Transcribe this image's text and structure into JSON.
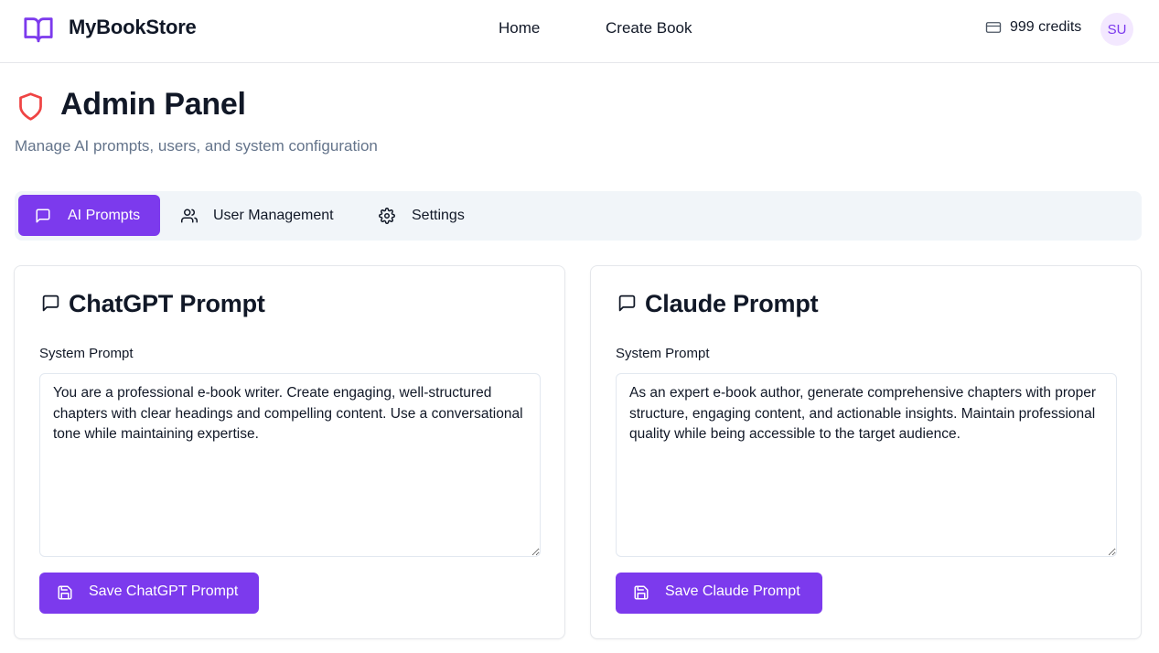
{
  "header": {
    "brand": "MyBookStore",
    "logo_icon": "book-open-icon",
    "nav": {
      "home": "Home",
      "create_book": "Create Book"
    },
    "credits": "999 credits",
    "credits_icon": "credit-card-icon",
    "avatar_initials": "SU"
  },
  "page": {
    "title": "Admin Panel",
    "title_icon": "shield-icon",
    "subtitle": "Manage AI prompts, users, and system configuration"
  },
  "tabs": [
    {
      "label": "AI Prompts",
      "icon": "message-square-icon",
      "active": true
    },
    {
      "label": "User Management",
      "icon": "users-icon",
      "active": false
    },
    {
      "label": "Settings",
      "icon": "gear-icon",
      "active": false
    }
  ],
  "cards": {
    "chatgpt": {
      "title": "ChatGPT Prompt",
      "field_label": "System Prompt",
      "prompt": "You are a professional e-book writer. Create engaging, well-structured chapters with clear headings and compelling content. Use a conversational tone while maintaining expertise.",
      "button": "Save ChatGPT Prompt"
    },
    "claude": {
      "title": "Claude Prompt",
      "field_label": "System Prompt",
      "prompt": "As an expert e-book author, generate comprehensive chapters with proper structure, engaging content, and actionable insights. Maintain professional quality while being accessible to the target audience.",
      "button": "Save Claude Prompt"
    }
  },
  "colors": {
    "accent": "#7c3aed",
    "shield": "#ef4444",
    "muted_text": "#64748b",
    "tab_bar_bg": "#f1f5f9",
    "avatar_bg": "#f3e8ff"
  }
}
